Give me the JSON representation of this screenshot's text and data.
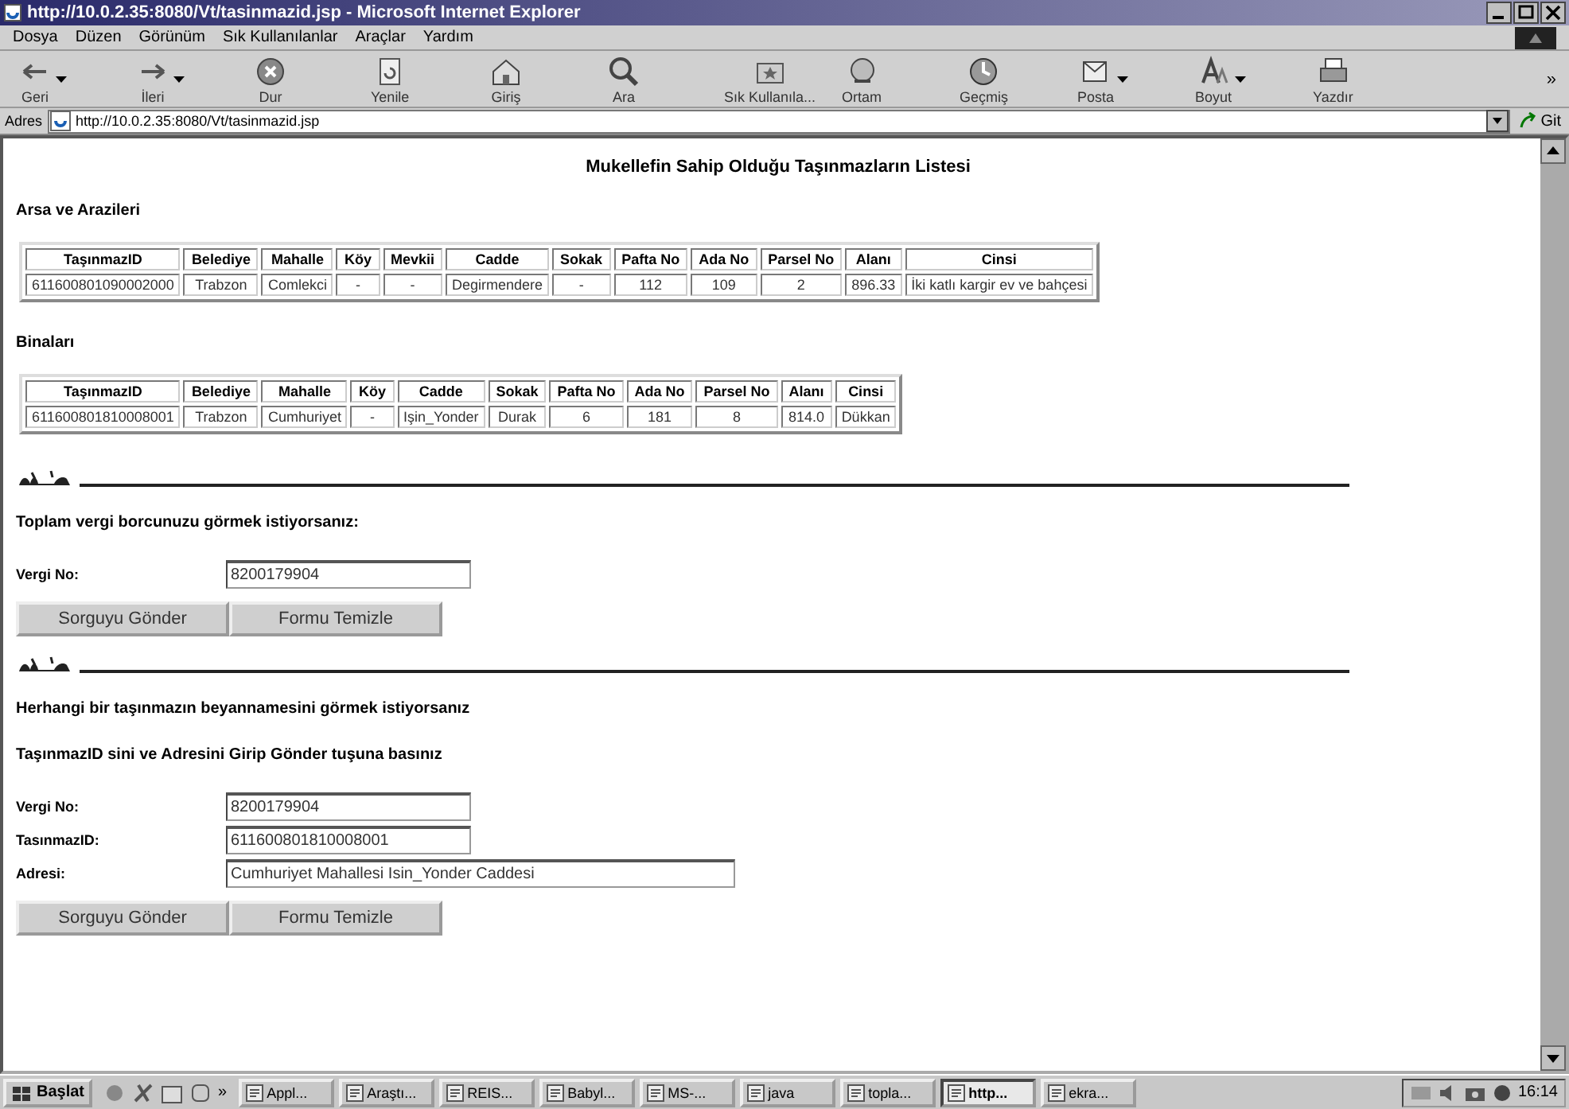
{
  "window": {
    "title": "http://10.0.2.35:8080/Vt/tasinmazid.jsp - Microsoft Internet Explorer"
  },
  "menu": [
    "Dosya",
    "Düzen",
    "Görünüm",
    "Sık Kullanılanlar",
    "Araçlar",
    "Yardım"
  ],
  "toolbar": [
    {
      "kind": "back",
      "label": "Geri",
      "dropdown": true
    },
    {
      "kind": "forward",
      "label": "İleri",
      "dropdown": true
    },
    {
      "kind": "stop",
      "label": "Dur",
      "dropdown": false
    },
    {
      "kind": "refresh",
      "label": "Yenile",
      "dropdown": false
    },
    {
      "kind": "home",
      "label": "Giriş",
      "dropdown": false
    },
    {
      "kind": "search",
      "label": "Ara",
      "dropdown": false
    },
    {
      "kind": "favorites",
      "label": "Sık Kullanıla...",
      "dropdown": false
    },
    {
      "kind": "media",
      "label": "Ortam",
      "dropdown": false
    },
    {
      "kind": "history",
      "label": "Geçmiş",
      "dropdown": false
    },
    {
      "kind": "mail",
      "label": "Posta",
      "dropdown": true
    },
    {
      "kind": "size",
      "label": "Boyut",
      "dropdown": true
    },
    {
      "kind": "print",
      "label": "Yazdır",
      "dropdown": false
    }
  ],
  "address": {
    "label": "Adres",
    "url": "http://10.0.2.35:8080/Vt/tasinmazid.jsp",
    "go": "Git"
  },
  "page": {
    "title": "Mukellefin Sahip Olduğu Taşınmazların Listesi",
    "tables": [
      {
        "heading": "Arsa ve Arazileri",
        "columns": [
          "TaşınmazID",
          "Belediye",
          "Mahalle",
          "Köy",
          "Mevkii",
          "Cadde",
          "Sokak",
          "Pafta No",
          "Ada No",
          "Parsel No",
          "Alanı",
          "Cinsi"
        ],
        "rows": [
          [
            "611600801090002000",
            "Trabzon",
            "Comlekci",
            "-",
            "-",
            "Degirmendere",
            "-",
            "112",
            "109",
            "2",
            "896.33",
            "İki katlı kargir ev ve bahçesi"
          ]
        ]
      },
      {
        "heading": "Binaları",
        "columns": [
          "TaşınmazID",
          "Belediye",
          "Mahalle",
          "Köy",
          "Cadde",
          "Sokak",
          "Pafta No",
          "Ada No",
          "Parsel No",
          "Alanı",
          "Cinsi"
        ],
        "rows": [
          [
            "611600801810008001",
            "Trabzon",
            "Cumhuriyet",
            "-",
            "Işin_Yonder",
            "Durak",
            "6",
            "181",
            "8",
            "814.0",
            "Dükkan"
          ]
        ]
      }
    ],
    "forms": [
      {
        "prompts": [
          "Toplam vergi borcunuzu görmek istiyorsanız:"
        ],
        "fields": [
          {
            "label": "Vergi No:",
            "value": "8200179904",
            "wide": false
          }
        ],
        "buttons": [
          "Sorguyu Gönder",
          "Formu Temizle"
        ]
      },
      {
        "prompts": [
          "Herhangi bir taşınmazın beyannamesini görmek istiyorsanız",
          "TaşınmazID sini ve Adresini Girip Gönder tuşuna basınız"
        ],
        "fields": [
          {
            "label": "Vergi No:",
            "value": "8200179904",
            "wide": false
          },
          {
            "label": "TasınmazID:",
            "value": "611600801810008001",
            "wide": false
          },
          {
            "label": "Adresi:",
            "value": "Cumhuriyet Mahallesi Isin_Yonder Caddesi",
            "wide": true
          }
        ],
        "buttons": [
          "Sorguyu Gönder",
          "Formu Temizle"
        ]
      }
    ]
  },
  "taskbar": {
    "start": "Başlat",
    "more": "»",
    "tasks": [
      {
        "label": "Appl...",
        "selected": false
      },
      {
        "label": "Araştı...",
        "selected": false
      },
      {
        "label": "REIS...",
        "selected": false
      },
      {
        "label": "Babyl...",
        "selected": false
      },
      {
        "label": "MS-...",
        "selected": false
      },
      {
        "label": "java",
        "selected": false
      },
      {
        "label": "topla...",
        "selected": false
      },
      {
        "label": "http...",
        "selected": true
      },
      {
        "label": "ekra...",
        "selected": false
      }
    ],
    "clock": "16:14"
  }
}
